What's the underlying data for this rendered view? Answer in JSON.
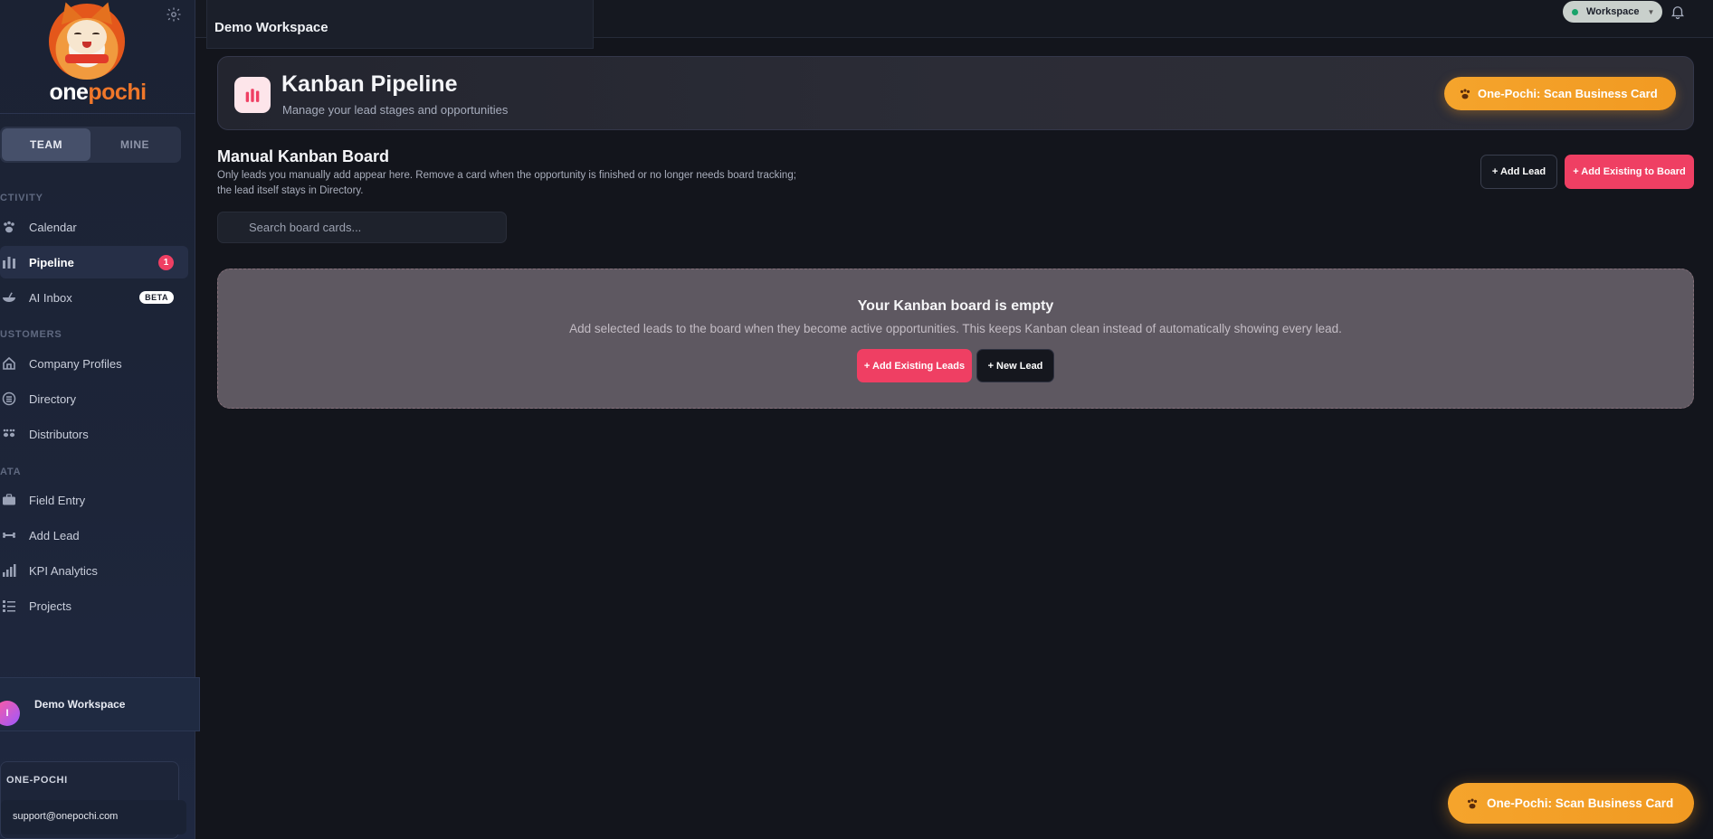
{
  "brand": {
    "logo_one": "one",
    "logo_pochi": "pochi"
  },
  "sidebar": {
    "toggle": {
      "team": "TEAM",
      "mine": "MINE"
    },
    "sections": [
      {
        "label": "CTIVITY"
      },
      {
        "label": "USTOMERS"
      },
      {
        "label": "ATA"
      }
    ],
    "items": [
      {
        "label": "Calendar",
        "icon": "paw-icon"
      },
      {
        "label": "Pipeline",
        "icon": "chart-bars-icon",
        "badge": "1"
      },
      {
        "label": "AI Inbox",
        "icon": "bowl-icon",
        "badge": "BETA"
      },
      {
        "label": "Company Profiles",
        "icon": "home-icon"
      },
      {
        "label": "Directory",
        "icon": "directory-icon"
      },
      {
        "label": "Distributors",
        "icon": "paws-icon"
      },
      {
        "label": "Field Entry",
        "icon": "briefcase-icon"
      },
      {
        "label": "Add Lead",
        "icon": "bone-icon"
      },
      {
        "label": "KPI Analytics",
        "icon": "analytics-icon"
      },
      {
        "label": "Projects",
        "icon": "list-icon"
      }
    ],
    "workspace": {
      "avatar_letter": "I",
      "name": "Demo Workspace"
    },
    "support_card": {
      "title": "ONE-POCHI",
      "email": "support@onepochi.com"
    }
  },
  "topbar": {
    "workspace_tab": "Demo Workspace",
    "workspace_pill": "Workspace"
  },
  "hero": {
    "title": "Kanban Pipeline",
    "subtitle": "Manage your lead stages and opportunities",
    "scan_button": "One-Pochi: Scan Business Card"
  },
  "board": {
    "title": "Manual Kanban Board",
    "description": "Only leads you manually add appear here. Remove a card when the opportunity is finished or no longer needs board tracking; the lead itself stays in Directory.",
    "add_lead": "+ Add Lead",
    "add_existing": "+ Add Existing to Board",
    "search_placeholder": "Search board cards..."
  },
  "empty_state": {
    "title": "Your Kanban board is empty",
    "subtitle": "Add selected leads to the board when they become active opportunities. This keeps Kanban clean instead of automatically showing every lead.",
    "add_existing": "+ Add Existing Leads",
    "new_lead": "+ New Lead"
  },
  "fab": {
    "label": "One-Pochi: Scan Business Card"
  },
  "colors": {
    "accent": "#ef3f63",
    "scan_orange": "#f5a42c",
    "sidebar_bg": "#1b2233",
    "main_bg": "#13151c"
  }
}
